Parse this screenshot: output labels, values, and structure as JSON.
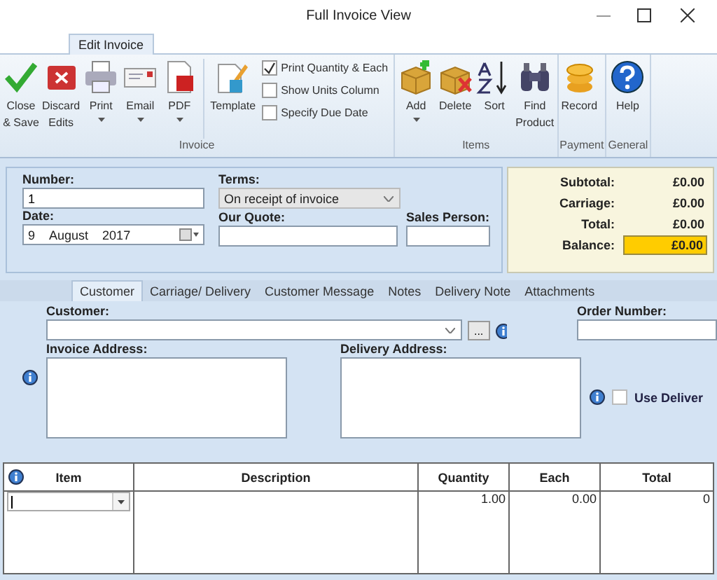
{
  "window": {
    "title": "Full Invoice View"
  },
  "ribbon": {
    "tab": {
      "label": "Edit Invoice",
      "selected": true
    },
    "groups": [
      {
        "label": "Invoice",
        "items": [
          {
            "kind": "button",
            "label": "Close\n& Save",
            "dropdown": false
          },
          {
            "kind": "button",
            "label": "Discard\nEdits",
            "dropdown": false
          },
          {
            "kind": "button",
            "label": "Print",
            "dropdown": true
          },
          {
            "kind": "button",
            "label": "Email",
            "dropdown": true
          },
          {
            "kind": "button",
            "label": "PDF",
            "dropdown": true
          },
          {
            "kind": "separator"
          },
          {
            "kind": "button",
            "label": "Template",
            "dropdown": false
          },
          {
            "kind": "checks",
            "checks": [
              {
                "label": "Print Quantity & Each",
                "checked": true
              },
              {
                "label": "Show Units Column",
                "checked": false
              },
              {
                "label": "Specify Due Date",
                "checked": false
              }
            ]
          }
        ]
      },
      {
        "label": "Items",
        "items": [
          {
            "kind": "button",
            "label": "Add",
            "dropdown": true
          },
          {
            "kind": "button",
            "label": "Delete",
            "dropdown": false
          },
          {
            "kind": "button",
            "label": "Sort",
            "dropdown": false
          },
          {
            "kind": "button",
            "label": "Find\nProduct",
            "dropdown": false
          }
        ]
      },
      {
        "label": "Payment",
        "items": [
          {
            "kind": "button",
            "label": "Record",
            "dropdown": false
          }
        ]
      },
      {
        "label": "General",
        "items": [
          {
            "kind": "button",
            "label": "Help",
            "dropdown": false
          }
        ]
      }
    ]
  },
  "header": {
    "number_label": "Number:",
    "number": "1",
    "date_label": "Date:",
    "date_day": "9",
    "date_month": "August",
    "date_year": "2017",
    "terms_label": "Terms:",
    "terms": "On receipt of invoice",
    "quote_label": "Our Quote:",
    "sales_person_label": "Sales Person:"
  },
  "totals": [
    {
      "label": "Subtotal:",
      "value": "£0.00",
      "highlighted": false
    },
    {
      "label": "Carriage:",
      "value": "£0.00",
      "highlighted": false
    },
    {
      "label": "Total:",
      "value": "£0.00",
      "highlighted": false
    },
    {
      "label": "Balance:",
      "value": "£0.00",
      "highlighted": true
    }
  ],
  "tabs": [
    {
      "label": "Customer",
      "selected": true
    },
    {
      "label": "Carriage/ Delivery",
      "selected": false
    },
    {
      "label": "Customer Message",
      "selected": false
    },
    {
      "label": "Notes",
      "selected": false
    },
    {
      "label": "Delivery Note",
      "selected": false
    },
    {
      "label": "Attachments",
      "selected": false
    }
  ],
  "customer": {
    "customer_label": "Customer:",
    "browse": "...",
    "order_number_label": "Order Number:",
    "invoice_address_label": "Invoice Address:",
    "delivery_address_label": "Delivery Address:",
    "use_delivery": {
      "label": "Use Deliver",
      "checked": false
    }
  },
  "grid": {
    "columns": [
      "Item",
      "Description",
      "Quantity",
      "Each",
      "Total"
    ],
    "rows": [
      {
        "item": "",
        "description": "",
        "quantity": "1.00",
        "each": "0.00",
        "total": "0"
      }
    ]
  }
}
